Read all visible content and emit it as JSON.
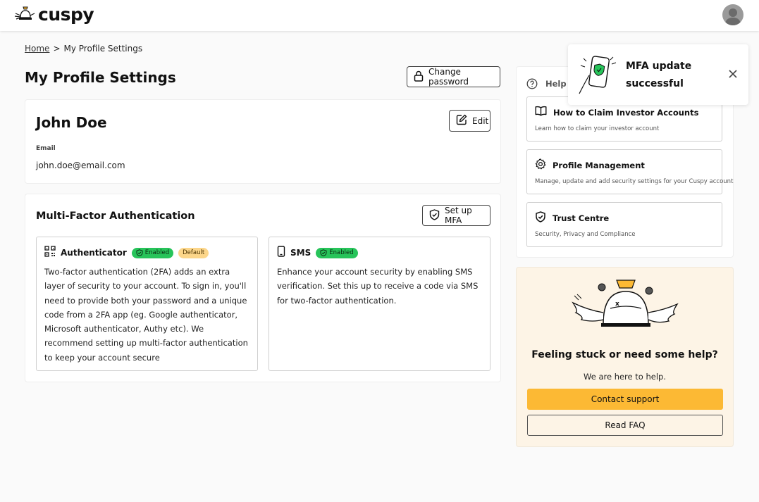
{
  "header": {
    "logo_text": "cuspy",
    "logo_icon": "cuspy-bell-icon",
    "avatar_icon": "user-avatar-icon"
  },
  "breadcrumb": {
    "home": "Home",
    "separator": ">",
    "current": "My Profile Settings"
  },
  "page": {
    "title": "My Profile Settings",
    "change_password_label": "Change password"
  },
  "profile": {
    "name": "John Doe",
    "edit_label": "Edit",
    "email_label": "Email",
    "email_value": "john.doe@email.com"
  },
  "mfa": {
    "title": "Multi-Factor Authentication",
    "setup_label": "Set up MFA",
    "methods": [
      {
        "name": "Authenticator",
        "icon": "qr-code-icon",
        "badges": [
          "Enabled",
          "Default"
        ],
        "description": "Two-factor authentication (2FA) adds an extra layer of security to your account. To sign in, you'll need to provide both your password and a unique code from a 2FA app (eg. Google authenticator, Microsoft authenticator, Authy etc). We recommend setting up multi-factor authentication to keep your account secure"
      },
      {
        "name": "SMS",
        "icon": "phone-icon",
        "badges": [
          "Enabled"
        ],
        "description": "Enhance your account security by enabling SMS verification. Set this up to receive a code via SMS for two-factor authentication."
      }
    ]
  },
  "help": {
    "title_partial": "Help D",
    "items": [
      {
        "title": "How to Claim Investor Accounts",
        "desc": "Learn how to claim your investor account",
        "icon": "book-icon"
      },
      {
        "title": "Profile Management",
        "desc": "Manage, update and add security settings for your Cuspy account",
        "icon": "gear-icon"
      },
      {
        "title": "Trust Centre",
        "desc": "Security, Privacy and Compliance",
        "icon": "shield-check-icon"
      }
    ]
  },
  "support": {
    "title": "Feeling stuck or need some help?",
    "subtitle": "We are here to help.",
    "contact_label": "Contact support",
    "faq_label": "Read FAQ"
  },
  "toast": {
    "message": "MFA update successful",
    "icon": "phone-shield-illustration"
  },
  "colors": {
    "accent": "#fcb934",
    "enabled_badge": "#27c45a",
    "default_badge": "#fcd68a",
    "support_bg": "#fdf4e6"
  }
}
